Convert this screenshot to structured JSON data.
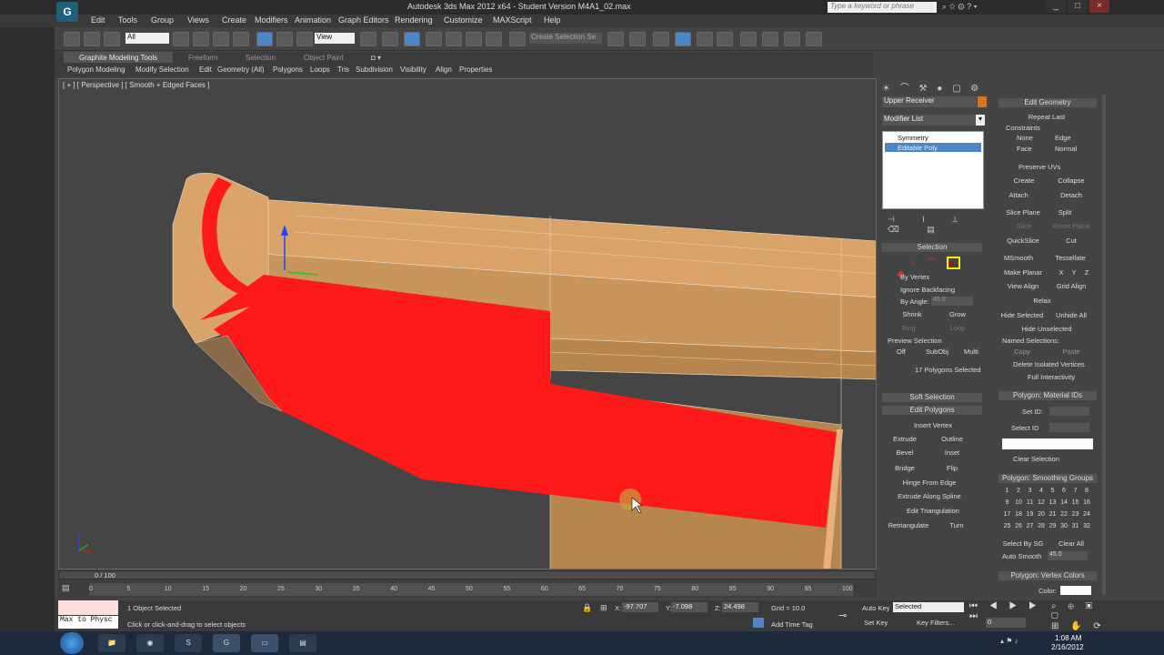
{
  "window": {
    "title": "Autodesk 3ds Max  2012 x64  - Student Version    M4A1_02.max",
    "search_placeholder": "Type a keyword or phrase"
  },
  "menu": [
    "Edit",
    "Tools",
    "Group",
    "Views",
    "Create",
    "Modifiers",
    "Animation",
    "Graph Editors",
    "Rendering",
    "Customize",
    "MAXScript",
    "Help"
  ],
  "toolbar": {
    "filter_value": "All",
    "ref_coord": "View",
    "named_selection": "Create Selection Se"
  },
  "ribbon": {
    "tabs": [
      "Graphite Modeling Tools",
      "Freeform",
      "Selection",
      "Object Paint"
    ],
    "subtabs": [
      "Polygon Modeling",
      "Modify Selection",
      "Edit",
      "Geometry (All)",
      "Polygons",
      "Loops",
      "Tris",
      "Subdivision",
      "Visibility",
      "Align",
      "Properties"
    ]
  },
  "viewport": {
    "label": "[ + ] [ Perspective ] [ Smooth + Edged Faces ]",
    "selection_color": "#ff1a1a",
    "model_color": "#c8955c"
  },
  "command_panel": {
    "object_name": "Upper Receiver",
    "modifier_list": "Modifier List",
    "stack": [
      "Symmetry",
      "Editable Poly"
    ],
    "selection": {
      "title": "Selection",
      "by_vertex": "By Vertex",
      "ignore_backfacing": "Ignore Backfacing",
      "by_angle": "By Angle:",
      "angle_value": "45.0",
      "shrink": "Shrink",
      "grow": "Grow",
      "ring": "Ring",
      "loop": "Loop",
      "preview": "Preview Selection",
      "preview_opts": [
        "Off",
        "SubObj",
        "Multi"
      ],
      "status": "17 Polygons Selected"
    },
    "soft_selection": "Soft Selection",
    "edit_polygons": {
      "title": "Edit Polygons",
      "insert_vertex": "Insert Vertex",
      "rows": [
        [
          "Extrude",
          "Outline"
        ],
        [
          "Bevel",
          "Inset"
        ],
        [
          "Bridge",
          "Flip"
        ]
      ],
      "hinge": "Hinge From Edge",
      "extrude_spline": "Extrude Along Spline",
      "edit_tri": "Edit Triangulation",
      "retriangulate": "Retriangulate",
      "turn": "Turn"
    }
  },
  "edit_geometry": {
    "title": "Edit Geometry",
    "repeat_last": "Repeat Last",
    "constraints": "Constraints",
    "constraint_opts": [
      "None",
      "Edge",
      "Face",
      "Normal"
    ],
    "preserve_uvs": "Preserve UVs",
    "create": "Create",
    "collapse": "Collapse",
    "attach": "Attach",
    "detach": "Detach",
    "slice_plane": "Slice Plane",
    "split": "Split",
    "slice": "Slice",
    "reset_plane": "Reset Plane",
    "quickslice": "QuickSlice",
    "cut": "Cut",
    "msmooth": "MSmooth",
    "tessellate": "Tessellate",
    "make_planar": "Make Planar",
    "x": "X",
    "y": "Y",
    "z": "Z",
    "view_align": "View Align",
    "grid_align": "Grid Align",
    "relax": "Relax",
    "hide_selected": "Hide Selected",
    "unhide_all": "Unhide All",
    "hide_unselected": "Hide Unselected",
    "named_selections": "Named Selections:",
    "copy": "Copy",
    "paste": "Paste",
    "delete_isolated": "Delete Isolated Vertices",
    "full_interactivity": "Full Interactivity"
  },
  "material_ids": {
    "title": "Polygon: Material IDs",
    "set_id": "Set ID:",
    "select_id": "Select ID",
    "clear_selection": "Clear Selection"
  },
  "smoothing_groups": {
    "title": "Polygon: Smoothing Groups",
    "numbers": [
      "1",
      "2",
      "3",
      "4",
      "5",
      "6",
      "7",
      "8",
      "9",
      "10",
      "11",
      "12",
      "13",
      "14",
      "15",
      "16",
      "17",
      "18",
      "19",
      "20",
      "21",
      "22",
      "23",
      "24",
      "25",
      "26",
      "27",
      "28",
      "29",
      "30",
      "31",
      "32"
    ],
    "select_by_sg": "Select By SG",
    "clear_all": "Clear All",
    "auto_smooth": "Auto Smooth",
    "auto_smooth_value": "45.0"
  },
  "vertex_colors": {
    "title": "Polygon: Vertex Colors",
    "color": "Color:"
  },
  "timeline": {
    "frame": "0 / 100",
    "ticks": [
      "0",
      "5",
      "10",
      "15",
      "20",
      "25",
      "30",
      "35",
      "40",
      "45",
      "50",
      "55",
      "60",
      "65",
      "70",
      "75",
      "80",
      "85",
      "90",
      "95",
      "100"
    ]
  },
  "status_bar": {
    "listener": "Max to Physc",
    "selected": "1 Object Selected",
    "prompt": "Click or click-and-drag to select objects",
    "x_label": "X:",
    "x_value": "-97.707",
    "y_label": "Y:",
    "y_value": "-7.098",
    "z_label": "Z:",
    "z_value": "24.498",
    "grid": "Grid = 10.0",
    "add_time_tag": "Add Time Tag",
    "auto_key": "Auto Key",
    "auto_key_value": "Selected",
    "set_key": "Set Key",
    "key_filters": "Key Filters...",
    "frame_value": "0"
  },
  "taskbar": {
    "time": "1:08 AM",
    "date": "2/16/2012"
  }
}
